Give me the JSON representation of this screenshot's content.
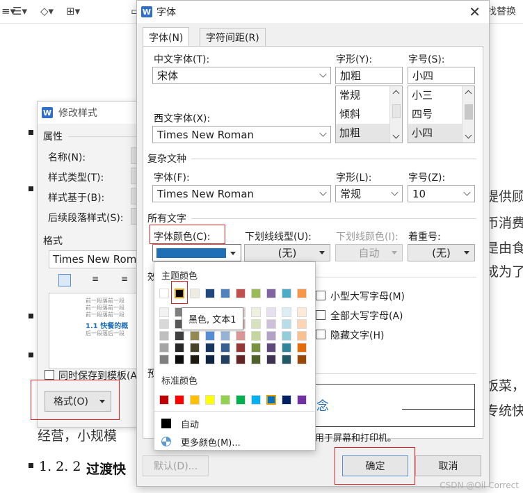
{
  "toolbar": {
    "find_replace": "找替换"
  },
  "document": {
    "frag1": "提供顾",
    "frag2": "币消费",
    "frag3": "是由食",
    "frag4": "成为了",
    "frag5": "饭菜，",
    "frag6": "专统快",
    "line_bottom": "经营，小规模",
    "heading_num": "1. 2. 2",
    "heading_text": "过渡快"
  },
  "style_dialog": {
    "title": "修改样式",
    "properties_label": "属性",
    "name_label": "名称(N):",
    "style_type_label": "样式类型(T):",
    "based_on_label": "样式基于(B):",
    "next_style_label": "后续段落样式(S):",
    "format_label": "格式",
    "font_value": "Times New Roma",
    "preview_lines": [
      "前一段落前一段",
      "前一段落前一段",
      "前一段落前一段"
    ],
    "preview_heading": "1.1 快餐的概",
    "preview_after": "后一段落后一段",
    "save_template": "同时保存到模板(A",
    "format_button": "格式(O)"
  },
  "font_dialog": {
    "title": "字体",
    "close": "✕",
    "tabs": [
      "字体(N)",
      "字符间距(R)"
    ],
    "cn_font_label": "中文字体(T):",
    "cn_font_value": "宋体",
    "western_font_label": "西文字体(X):",
    "western_font_value": "Times New Roman",
    "style_label": "字形(Y):",
    "style_value": "加粗",
    "style_options": [
      "常规",
      "倾斜",
      "加粗"
    ],
    "size_label": "字号(S):",
    "size_value": "小四",
    "size_options": [
      "小三",
      "四号",
      "小四"
    ],
    "complex_section": "复杂文种",
    "complex_font_label": "字体(F):",
    "complex_font_value": "Times New Roman",
    "complex_style_label": "字形(L):",
    "complex_style_value": "常规",
    "complex_size_label": "字号(Z):",
    "complex_size_value": "10",
    "all_text_section": "所有文字",
    "font_color_label": "字体颜色(C):",
    "font_color": "#1f6fb7",
    "underline_type_label": "下划线线型(U):",
    "underline_type_value": "(无)",
    "underline_color_label": "下划线颜色(I):",
    "underline_color_value": "自动",
    "emphasis_label": "着重号:",
    "emphasis_value": "(无)",
    "effects_section": "效",
    "small_caps": "小型大写字母(M)",
    "all_caps": "全部大写字母(A)",
    "hidden": "隐藏文字(H)",
    "preview_section": "预",
    "preview_text": "念",
    "footnote": "用于屏幕和打印机。",
    "default_button": "默认(D)...",
    "ok_button": "确定",
    "cancel_button": "取消"
  },
  "color_picker": {
    "theme_header": "主题颜色",
    "standard_header": "标准颜色",
    "tooltip": "黑色, 文本1",
    "auto_label": "自动",
    "more_label": "更多颜色(M)...",
    "theme_top": [
      "#ffffff",
      "#000000",
      "#eeece1",
      "#1f497d",
      "#4f81bd",
      "#c0504d",
      "#9bbb59",
      "#8064a2",
      "#4bacc6",
      "#f79646"
    ],
    "theme_shades": [
      [
        "#f2f2f2",
        "#7f7f7f",
        "#ddd9c3",
        "#c6d9f0",
        "#dbe5f1",
        "#f2dcdb",
        "#ebf1dd",
        "#e5e0ec",
        "#dbeef3",
        "#fdeada"
      ],
      [
        "#d8d8d8",
        "#595959",
        "#c4bd97",
        "#8db3e2",
        "#b8cce4",
        "#e5b9b7",
        "#d7e3bc",
        "#ccc1d9",
        "#b7dde8",
        "#fbd5b5"
      ],
      [
        "#bfbfbf",
        "#3f3f3f",
        "#938953",
        "#548dd4",
        "#95b3d7",
        "#d99694",
        "#c3d69b",
        "#b2a2c7",
        "#92cddc",
        "#fac08f"
      ],
      [
        "#a5a5a5",
        "#262626",
        "#494429",
        "#17365d",
        "#366092",
        "#953734",
        "#76923c",
        "#5f497a",
        "#31859b",
        "#e36c09"
      ],
      [
        "#7f7f7f",
        "#0c0c0c",
        "#1d1b10",
        "#0f243e",
        "#244061",
        "#632423",
        "#4f6128",
        "#3f3151",
        "#205867",
        "#974806"
      ]
    ],
    "standard": [
      "#c00000",
      "#ff0000",
      "#ffc000",
      "#ffff00",
      "#92d050",
      "#00b050",
      "#00b0f0",
      "#0070c0",
      "#002060",
      "#7030a0"
    ]
  }
}
